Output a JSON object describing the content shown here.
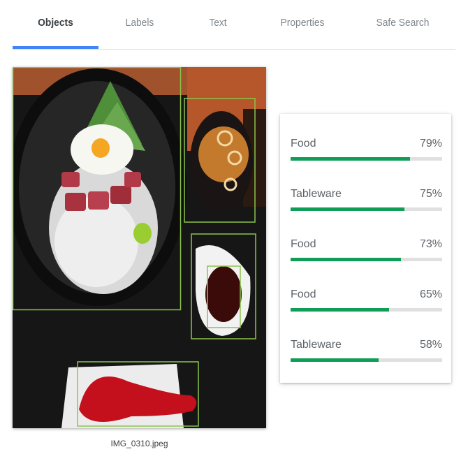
{
  "tabs": [
    {
      "label": "Objects",
      "active": true
    },
    {
      "label": "Labels",
      "active": false
    },
    {
      "label": "Text",
      "active": false
    },
    {
      "label": "Properties",
      "active": false
    },
    {
      "label": "Safe Search",
      "active": false
    }
  ],
  "image": {
    "filename": "IMG_0310.jpeg",
    "box_color": "#8bc34a"
  },
  "objects": [
    {
      "label": "Food",
      "score": "79%",
      "fraction": 0.79
    },
    {
      "label": "Tableware",
      "score": "75%",
      "fraction": 0.75
    },
    {
      "label": "Food",
      "score": "73%",
      "fraction": 0.73
    },
    {
      "label": "Food",
      "score": "65%",
      "fraction": 0.65
    },
    {
      "label": "Tableware",
      "score": "58%",
      "fraction": 0.58
    }
  ],
  "colors": {
    "accent": "#4285f4",
    "bar": "#0f9d58",
    "track": "#e0e0e0"
  }
}
